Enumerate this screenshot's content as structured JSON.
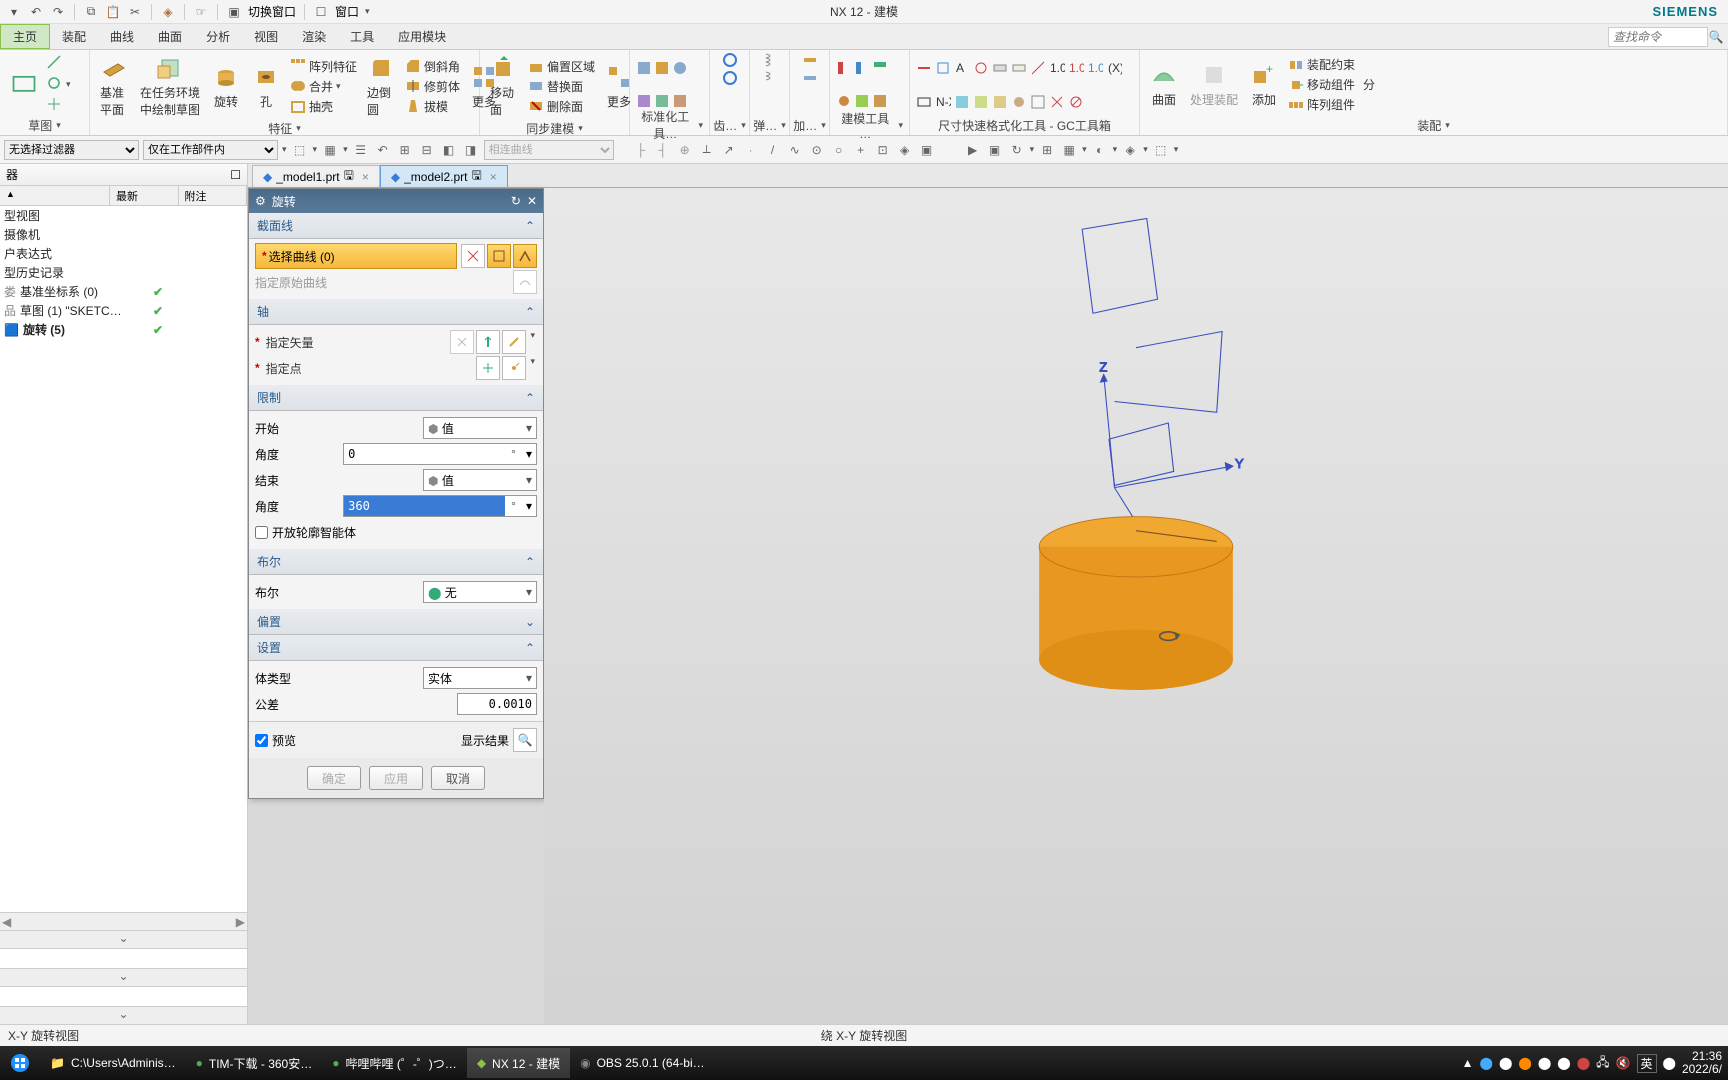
{
  "titlebar": {
    "switch_window": "切换窗口",
    "window": "窗口",
    "title": "NX 12 - 建模",
    "brand": "SIEMENS"
  },
  "menu": {
    "items": [
      "主页",
      "装配",
      "曲线",
      "曲面",
      "分析",
      "视图",
      "渲染",
      "工具",
      "应用模块"
    ],
    "search_placeholder": "查找命令"
  },
  "ribbon": {
    "g1_label": "草图",
    "g1_datum": "基准平面",
    "g1_sketch": "在任务环境\n中绘制草图",
    "g2_label": "特征",
    "g2_revolve": "旋转",
    "g2_hole": "孔",
    "g2_pattern": "阵列特征",
    "g2_unite": "合并",
    "g2_shell": "抽壳",
    "g2_edge": "边倒圆",
    "g2_chamfer": "倒斜角",
    "g2_trim": "修剪体",
    "g2_draft": "拔模",
    "g2_more": "更多",
    "g3_label": "同步建模",
    "g3_move": "移动面",
    "g3_offset": "偏置区域",
    "g3_replace": "替换面",
    "g3_delete": "删除面",
    "g3_more": "更多",
    "g4_label": "标准化工具…",
    "g5_label": "齿…",
    "g6_label": "弹…",
    "g7_label": "加…",
    "g8_label": "建模工具 …",
    "g9_label": "尺寸快速格式化工具 - GC工具箱",
    "g10_label": "装配",
    "g10_curve": "曲面",
    "g10_process": "处理装配",
    "g10_add": "添加",
    "g10_constraint": "装配约束",
    "g10_movecomp": "移动组件",
    "g10_pattern": "阵列组件",
    "g10_share": "分"
  },
  "filter": {
    "sel1": "无选择过滤器",
    "sel2": "仅在工作部件内",
    "sel3": "相连曲线"
  },
  "left": {
    "header": "器",
    "cols": [
      "",
      "最新",
      "附注"
    ],
    "rows": [
      {
        "t": "型视图",
        "b": false,
        "c": false
      },
      {
        "t": "摄像机",
        "b": false,
        "c": false
      },
      {
        "t": "户表达式",
        "b": false,
        "c": false
      },
      {
        "t": "型历史记录",
        "b": false,
        "c": false
      },
      {
        "t": "基准坐标系 (0)",
        "b": false,
        "c": true,
        "pre": "娄"
      },
      {
        "t": "草图 (1) \"SKETC…",
        "b": false,
        "c": true,
        "pre": "品"
      },
      {
        "t": "旋转 (5)",
        "b": true,
        "c": true,
        "ico": "rev"
      }
    ]
  },
  "tabs": [
    {
      "label": "_model1.prt",
      "active": false,
      "mod": true
    },
    {
      "label": "_model2.prt",
      "active": true,
      "mod": true
    }
  ],
  "dialog": {
    "title": "旋转",
    "sec1": "截面线",
    "select_curve": "选择曲线 (0)",
    "orig_curve": "指定原始曲线",
    "sec2": "轴",
    "spec_vector": "指定矢量",
    "spec_point": "指定点",
    "sec3": "限制",
    "start": "开始",
    "start_val": "值",
    "angle": "角度",
    "start_angle": "0",
    "end": "结束",
    "end_val": "值",
    "end_angle": "360",
    "open_profile": "开放轮廓智能体",
    "sec4": "布尔",
    "bool_label": "布尔",
    "bool_val": "无",
    "sec5": "偏置",
    "sec6": "设置",
    "body_type": "体类型",
    "body_val": "实体",
    "tolerance": "公差",
    "tol_val": "0.0010",
    "preview": "预览",
    "show_result": "显示结果",
    "ok": "确定",
    "apply": "应用",
    "cancel": "取消"
  },
  "status": {
    "left": "X-Y 旋转视图",
    "center": "绕 X-Y 旋转视图"
  },
  "taskbar": {
    "tasks": [
      {
        "label": "C:\\Users\\Adminis…",
        "color": "#f0c040"
      },
      {
        "label": "TIM-下载 - 360安…",
        "color": "#4caf50"
      },
      {
        "label": "哔哩哔哩 (゜-゜)つ…",
        "color": "#4caf50"
      },
      {
        "label": "NX 12 - 建模",
        "color": "#8bc34a",
        "active": true
      },
      {
        "label": "OBS 25.0.1 (64-bi…",
        "color": "#555"
      }
    ],
    "ime": "英",
    "time": "21:36",
    "date": "2022/6/"
  }
}
